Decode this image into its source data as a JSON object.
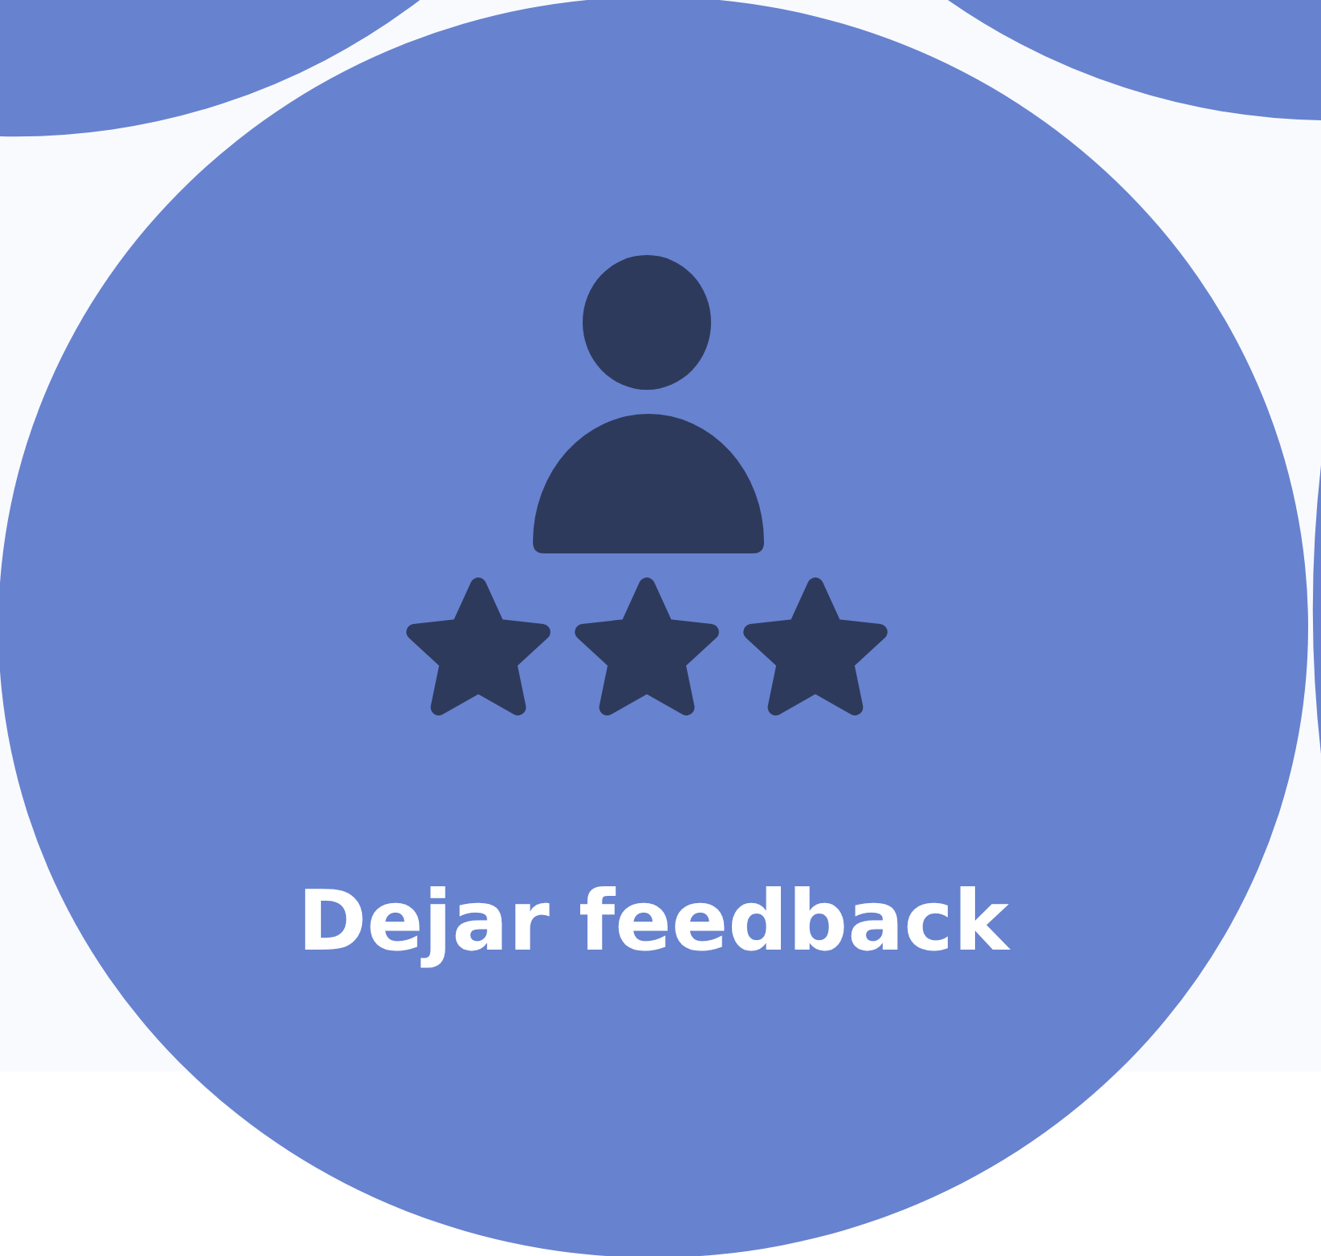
{
  "feedback_button": {
    "label": "Dejar feedback"
  }
}
